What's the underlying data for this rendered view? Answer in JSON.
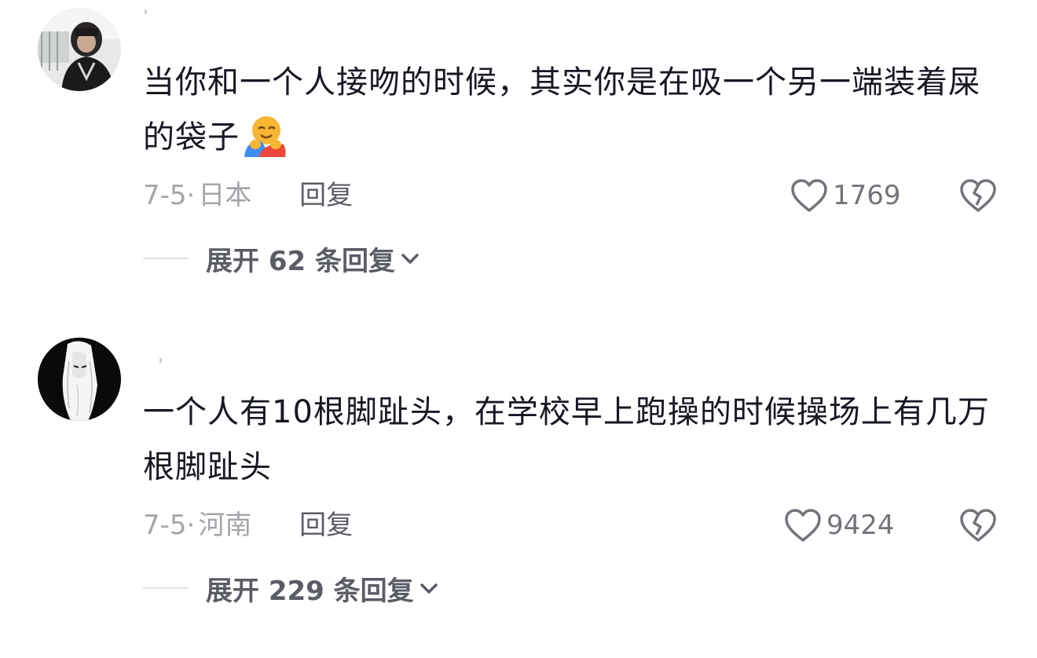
{
  "comments": [
    {
      "avatar": "avatar-photo-hooded-person",
      "text": "当你和一个人接吻的时候，其实你是在吸一个另一端装着屎的袋子",
      "emoji": "hugging-face-emoji",
      "date": "7-5·",
      "region": "日本",
      "reply_label": "回复",
      "like_count": "1769",
      "expand_label": "展开 62 条回复"
    },
    {
      "avatar": "avatar-anime-girl",
      "text": "一个人有10根脚趾头，在学校早上跑操的时候操场上有几万根脚趾头",
      "emoji": "",
      "date": "7-5·",
      "region": "河南",
      "reply_label": "回复",
      "like_count": "9424",
      "expand_label": "展开 229 条回复"
    }
  ],
  "icons": {
    "like": "heart-outline-icon",
    "dislike": "broken-heart-icon",
    "expand": "chevron-down-icon"
  },
  "colors": {
    "text_primary": "#161823",
    "text_secondary": "#a4a5aa",
    "action": "#5a5c66"
  }
}
